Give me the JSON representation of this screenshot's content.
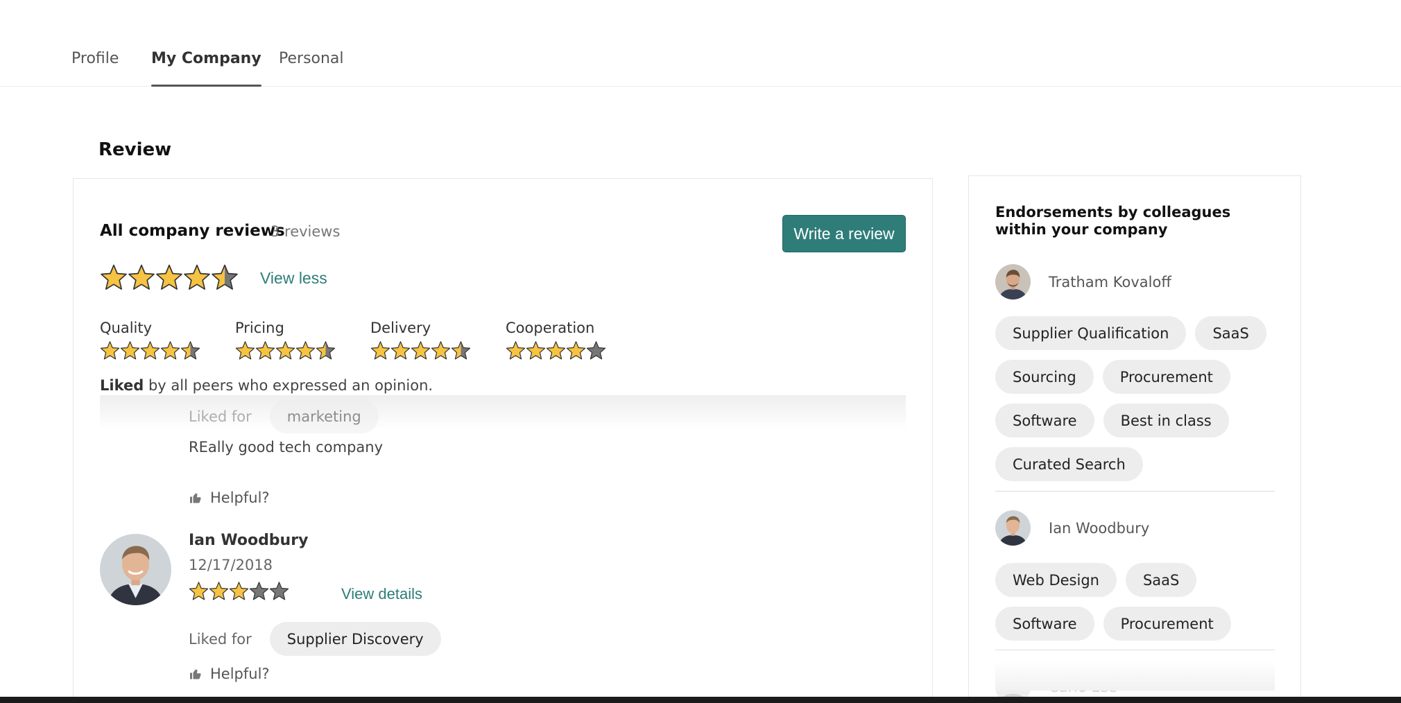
{
  "tabs": [
    {
      "label": "Profile",
      "active": false
    },
    {
      "label": "My Company",
      "active": true
    },
    {
      "label": "Personal",
      "active": false
    }
  ],
  "section_title": "Review",
  "reviews_panel": {
    "heading": "All company reviews",
    "count": "3 reviews",
    "write_button": "Write a review",
    "overall_rating": 4.5,
    "view_less": "View less",
    "categories": [
      {
        "label": "Quality",
        "rating": 4.5
      },
      {
        "label": "Pricing",
        "rating": 4.5
      },
      {
        "label": "Delivery",
        "rating": 4.5
      },
      {
        "label": "Cooperation",
        "rating": 4
      }
    ],
    "liked_prefix": "Liked",
    "liked_suffix": " by all peers who expressed an opinion.",
    "faded_review": {
      "liked_for_label": "Liked for",
      "liked_for_tag": "marketing",
      "text": "REally good tech company",
      "helpful": "Helpful?"
    },
    "review": {
      "name": "Ian Woodbury",
      "date": "12/17/2018",
      "rating": 3,
      "view_details": "View details",
      "liked_for_label": "Liked for",
      "liked_for_tag": "Supplier Discovery",
      "helpful": "Helpful?"
    }
  },
  "endorsements": {
    "title": "Endorsements by colleagues within your company",
    "people": [
      {
        "name": "Tratham Kovaloff",
        "tags": [
          "Supplier Qualification",
          "SaaS",
          "Sourcing",
          "Procurement",
          "Software",
          "Best in class",
          "Curated Search"
        ]
      },
      {
        "name": "Ian Woodbury",
        "tags": [
          "Web Design",
          "SaaS",
          "Software",
          "Procurement"
        ]
      },
      {
        "name": "Carlo Lee",
        "tags": []
      }
    ]
  },
  "colors": {
    "accent": "#2e7d79",
    "star_fill": "#f6c343",
    "star_empty": "#777777",
    "chip_bg": "#ededed"
  }
}
